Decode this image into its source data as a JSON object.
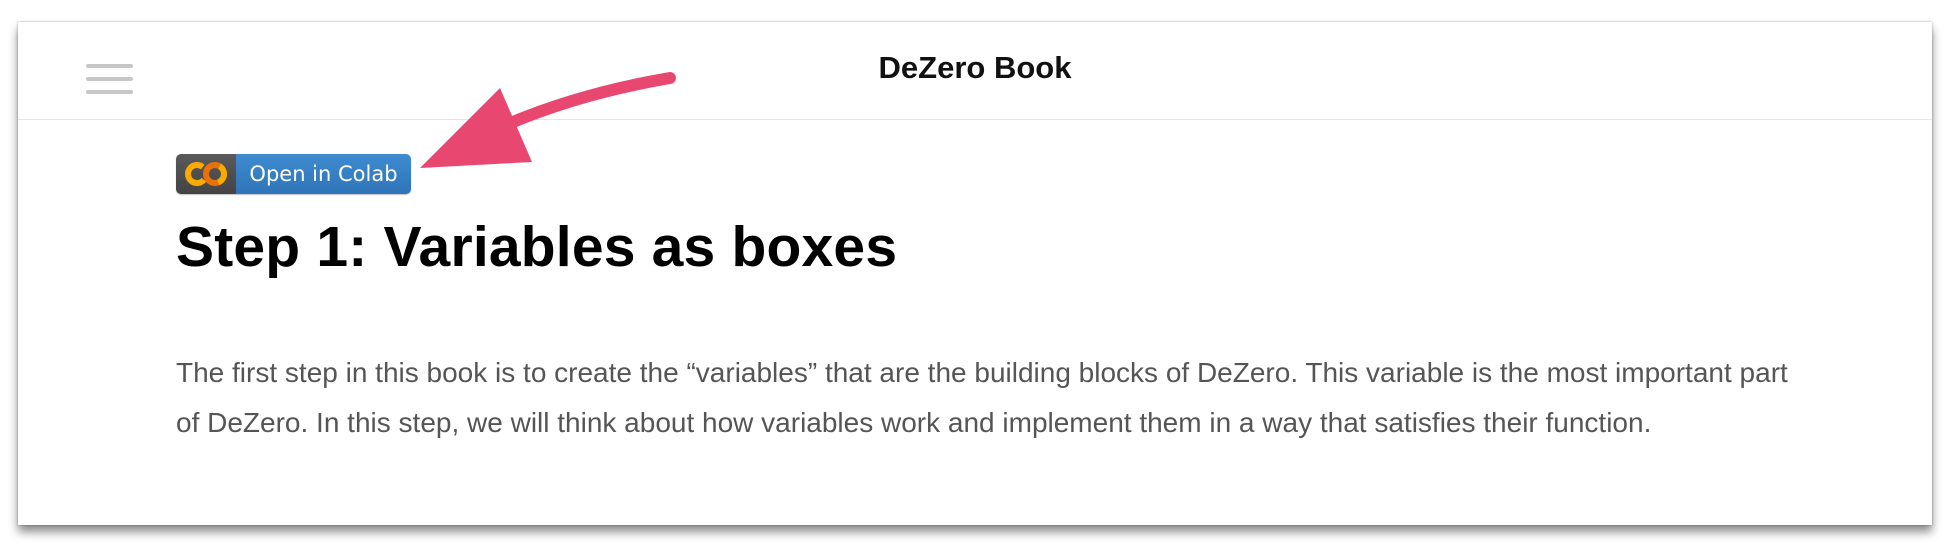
{
  "header": {
    "book_title": "DeZero Book",
    "menu_icon": "hamburger-menu-icon"
  },
  "badge": {
    "logo_text": "CO",
    "label": "Open in Colab",
    "logo_color": "#f9ab00",
    "label_bg": "#3f8bd0"
  },
  "content": {
    "title": "Step 1: Variables as boxes",
    "intro": "The first step in this book is to create the “variables” that are the building blocks of DeZero. This variable is the most important part of DeZero. In this step, we will think about how variables work and implement them in a way that satisfies their function."
  },
  "annotation": {
    "arrow_icon": "pointer-arrow-icon",
    "arrow_color": "#e8486f"
  }
}
